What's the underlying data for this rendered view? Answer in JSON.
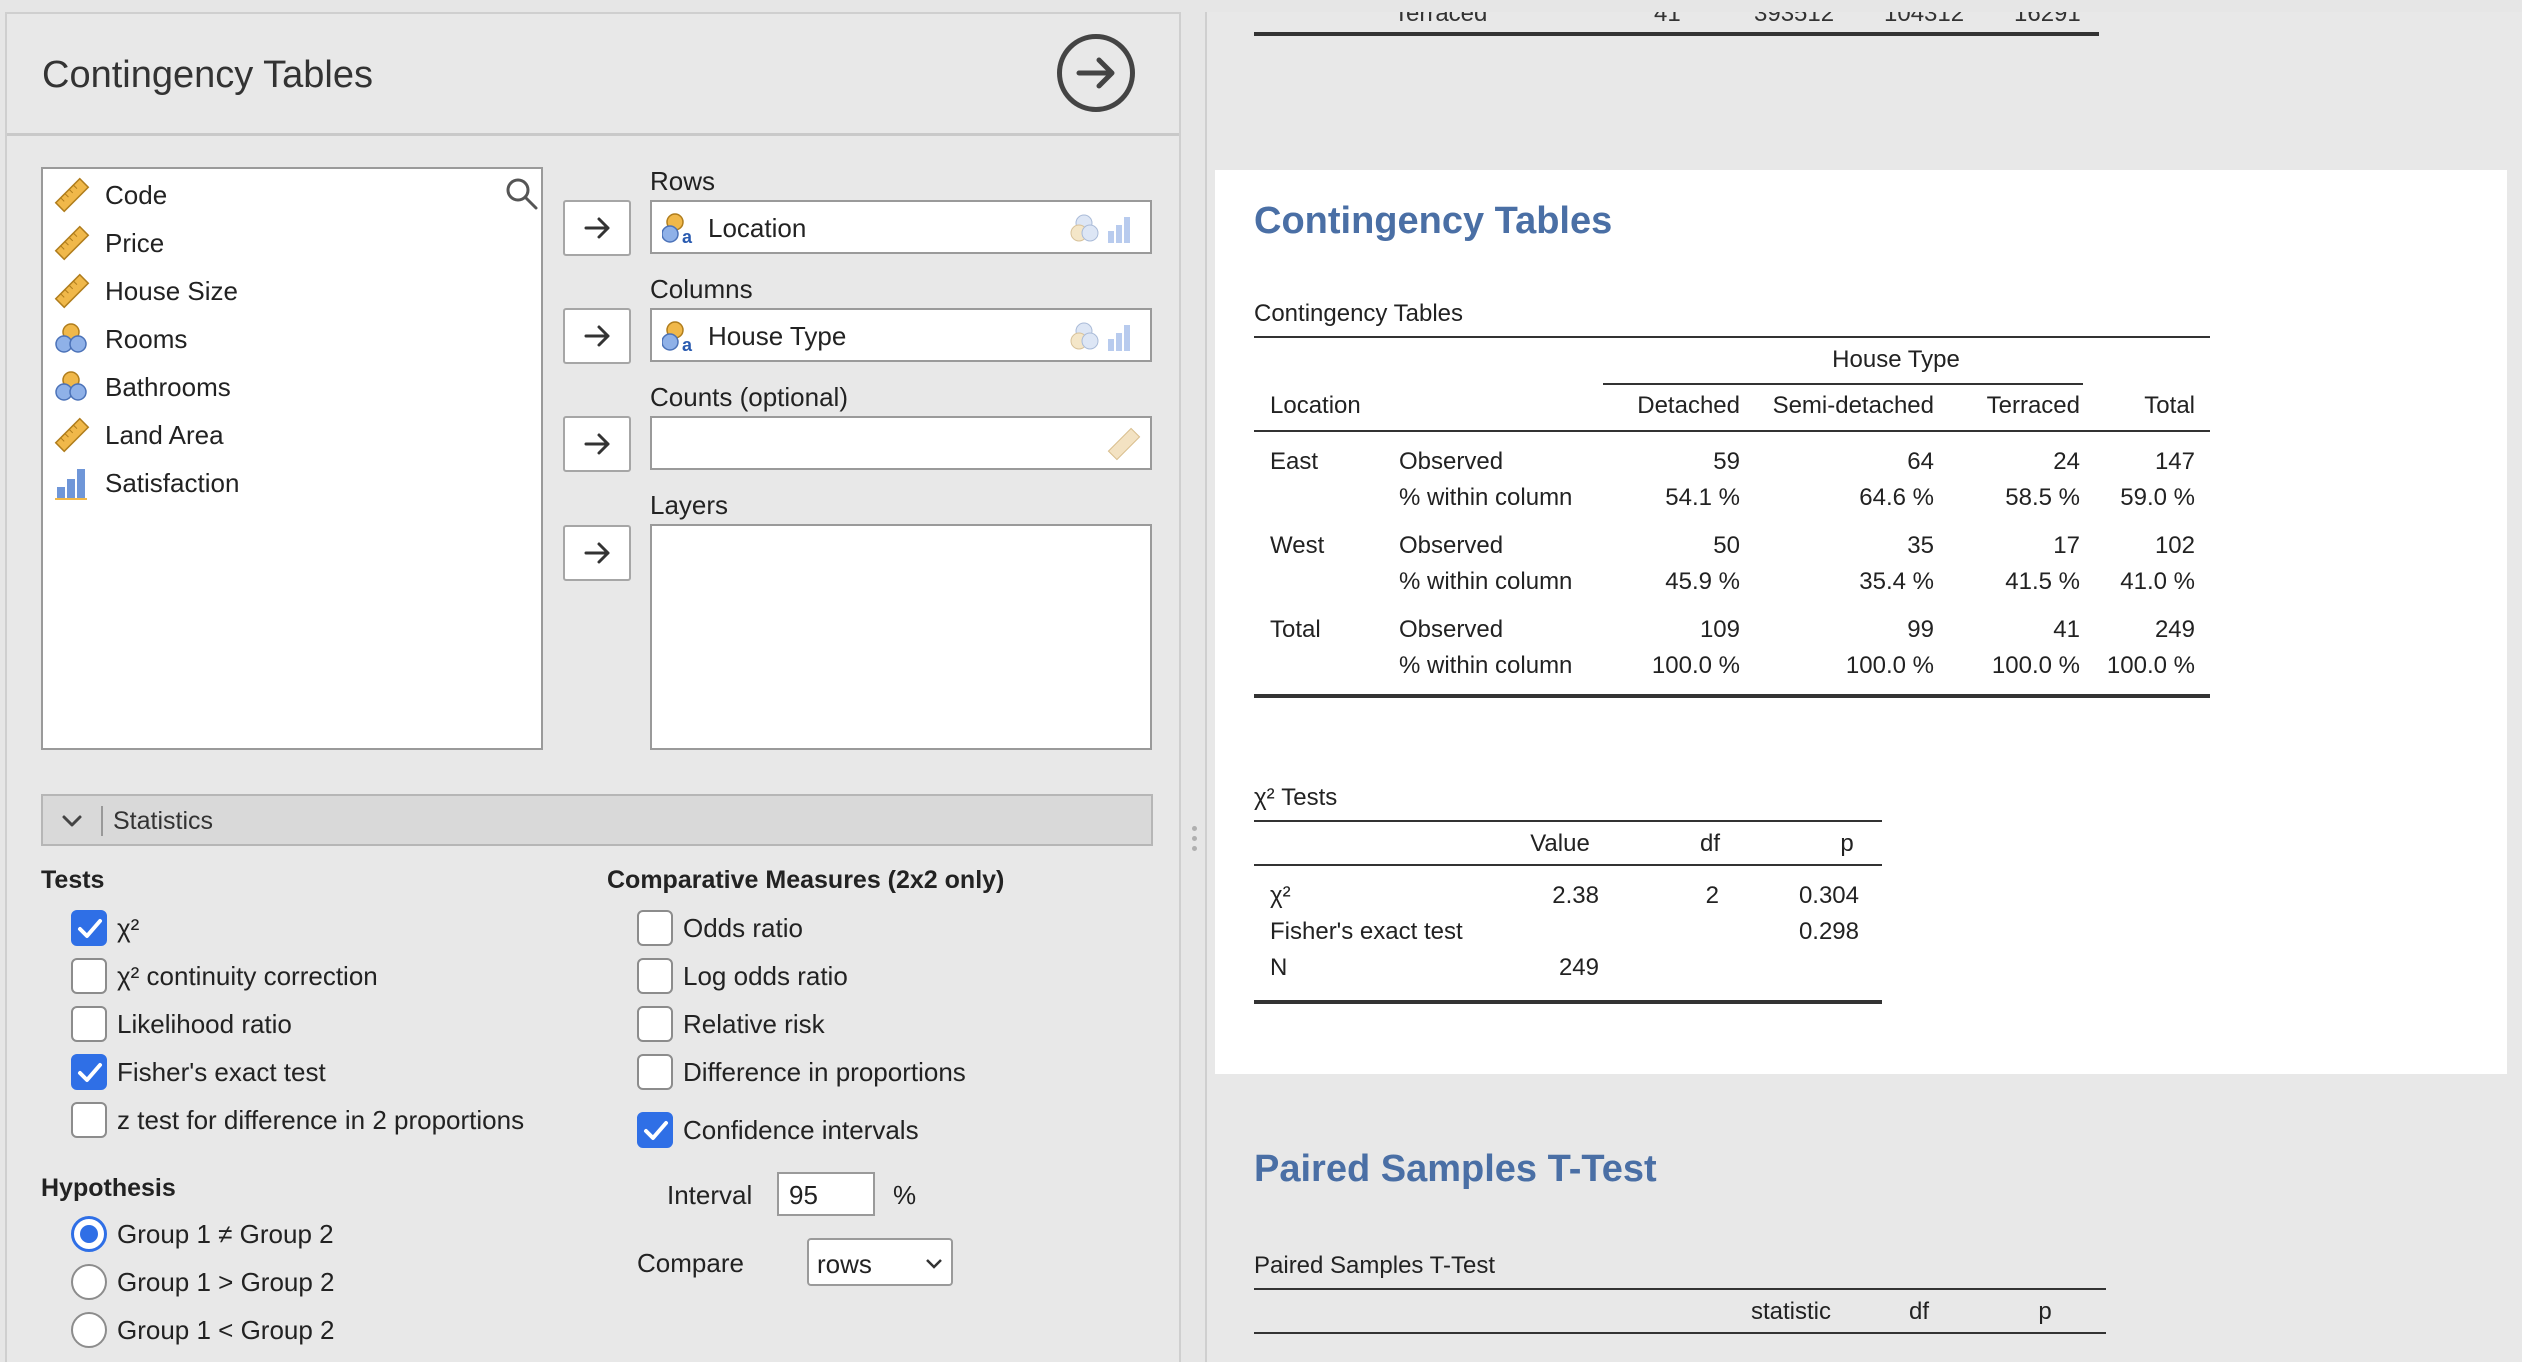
{
  "left_panel": {
    "title": "Contingency Tables",
    "variables": [
      {
        "name": "Code",
        "type_icon": "scale-ruler-icon"
      },
      {
        "name": "Price",
        "type_icon": "scale-ruler-icon"
      },
      {
        "name": "House Size",
        "type_icon": "scale-ruler-icon"
      },
      {
        "name": "Rooms",
        "type_icon": "nominal-circles-icon"
      },
      {
        "name": "Bathrooms",
        "type_icon": "nominal-circles-icon"
      },
      {
        "name": "Land Area",
        "type_icon": "scale-ruler-icon"
      },
      {
        "name": "Satisfaction",
        "type_icon": "ordinal-bars-icon"
      }
    ],
    "rows": {
      "label": "Rows",
      "value": "Location"
    },
    "columns": {
      "label": "Columns",
      "value": "House Type"
    },
    "counts": {
      "label": "Counts (optional)",
      "value": ""
    },
    "layers": {
      "label": "Layers"
    },
    "statistics_section": "Statistics",
    "tests": {
      "title": "Tests",
      "options": [
        {
          "label": "χ²",
          "checked": true
        },
        {
          "label": "χ² continuity correction",
          "checked": false
        },
        {
          "label": "Likelihood ratio",
          "checked": false
        },
        {
          "label": "Fisher's exact test",
          "checked": true
        },
        {
          "label": "z test for difference in 2 proportions",
          "checked": false
        }
      ]
    },
    "hypothesis": {
      "title": "Hypothesis",
      "options": [
        {
          "label": "Group 1 ≠ Group 2",
          "checked": true
        },
        {
          "label": "Group 1 > Group 2",
          "checked": false
        },
        {
          "label": "Group 1 < Group 2",
          "checked": false
        }
      ]
    },
    "comparative": {
      "title": "Comparative Measures (2x2 only)",
      "options": [
        {
          "label": "Odds ratio",
          "checked": false
        },
        {
          "label": "Log odds ratio",
          "checked": false
        },
        {
          "label": "Relative risk",
          "checked": false
        },
        {
          "label": "Difference in proportions",
          "checked": false
        },
        {
          "label": "Confidence intervals",
          "checked": true
        }
      ],
      "interval_label": "Interval",
      "interval_value": "95",
      "interval_unit": "%",
      "compare_label": "Compare",
      "compare_value": "rows"
    }
  },
  "right_panel": {
    "previous_row": {
      "label": "Terraced",
      "values": [
        "41",
        "393512",
        "104312",
        "16291"
      ]
    },
    "results_title": "Contingency Tables",
    "contingency": {
      "caption": "Contingency Tables",
      "group_header": "House Type",
      "row_header": "Location",
      "columns": [
        "Detached",
        "Semi-detached",
        "Terraced",
        "Total"
      ],
      "rows": [
        {
          "group": "East",
          "stat": "Observed",
          "values": [
            "59",
            "64",
            "24",
            "147"
          ]
        },
        {
          "group": "",
          "stat": "% within column",
          "values": [
            "54.1 %",
            "64.6 %",
            "58.5 %",
            "59.0 %"
          ]
        },
        {
          "group": "West",
          "stat": "Observed",
          "values": [
            "50",
            "35",
            "17",
            "102"
          ]
        },
        {
          "group": "",
          "stat": "% within column",
          "values": [
            "45.9 %",
            "35.4 %",
            "41.5 %",
            "41.0 %"
          ]
        },
        {
          "group": "Total",
          "stat": "Observed",
          "values": [
            "109",
            "99",
            "41",
            "249"
          ]
        },
        {
          "group": "",
          "stat": "% within column",
          "values": [
            "100.0 %",
            "100.0 %",
            "100.0 %",
            "100.0 %"
          ]
        }
      ]
    },
    "chi_tests": {
      "caption": "χ² Tests",
      "columns": [
        "Value",
        "df",
        "p"
      ],
      "rows": [
        {
          "label": "χ²",
          "value": "2.38",
          "df": "2",
          "p": "0.304"
        },
        {
          "label": "Fisher's exact test",
          "value": "",
          "df": "",
          "p": "0.298"
        },
        {
          "label": "N",
          "value": "249",
          "df": "",
          "p": ""
        }
      ]
    },
    "paired": {
      "title": "Paired Samples T-Test",
      "caption": "Paired Samples T-Test",
      "columns": [
        "statistic",
        "df",
        "p"
      ]
    }
  }
}
